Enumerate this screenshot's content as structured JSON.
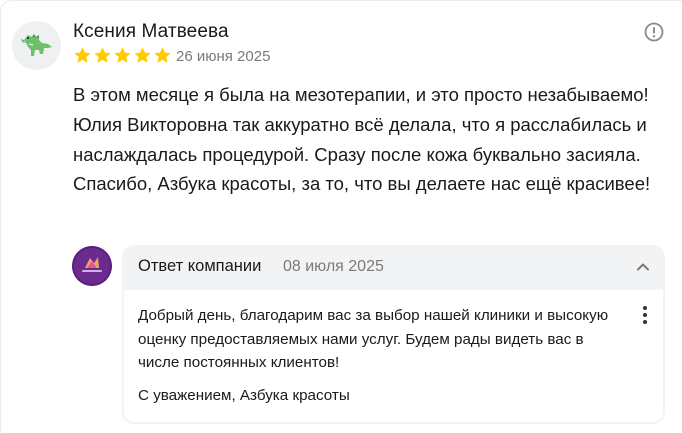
{
  "review": {
    "author": "Ксения Матвеева",
    "rating": 5,
    "date": "26 июня 2025",
    "text": "В этом месяце я была на мезотерапии, и это просто незабываемо! Юлия Викторовна так аккуратно всё делала, что я расслабилась и наслаждалась процедурой. Сразу после кожа буквально засияла. Спасибо, Азбука красоты, за то, что вы делаете нас ещё красивее!",
    "avatar_icon": "dinosaur-icon",
    "star_color": "#ffcc00"
  },
  "reply": {
    "title": "Ответ компании",
    "date": "08 июля 2025",
    "text": "Добрый день, благодарим вас за выбор нашей клиники и высокую оценку предоставляемых нами услуг. Будем рады видеть вас в числе постоянных клиентов!",
    "signature": "С уважением, Азбука красоты",
    "avatar_icon": "company-logo-icon",
    "logo_text": "Азбука Красоты"
  }
}
